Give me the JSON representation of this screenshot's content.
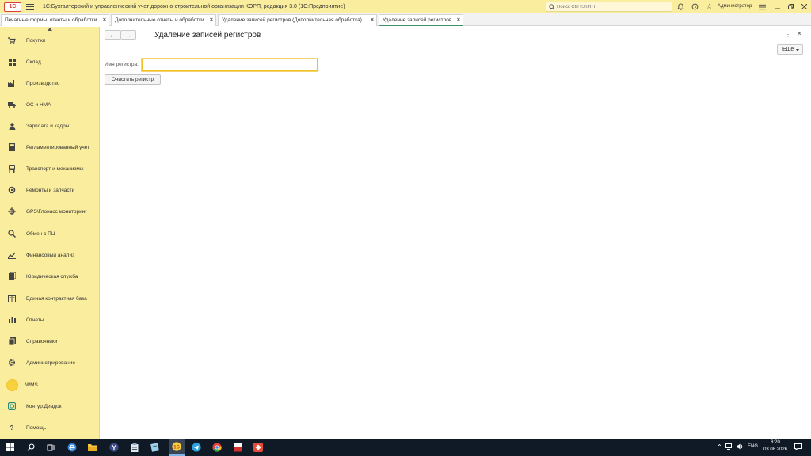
{
  "app": {
    "logo_text": "1С",
    "title": "1С:Бухгалтерский и управленческий учет дорожно-строительной организации КОРП, редакция 3.0  (1С:Предприятие)",
    "search_placeholder": "Поиск Ctrl+Shift+F",
    "user": "Администратор"
  },
  "tabs": [
    {
      "label": "Печатные формы, отчеты и обработки"
    },
    {
      "label": "Дополнительные отчеты и обработки"
    },
    {
      "label": "Удаление записей регистров (Дополнительная обработка)"
    },
    {
      "label": "Удаление записей регистров",
      "active": true
    }
  ],
  "sidebar": {
    "items": [
      {
        "label": "Покупки",
        "icon": "cart-icon"
      },
      {
        "label": "Склад",
        "icon": "warehouse-icon"
      },
      {
        "label": "Производство",
        "icon": "factory-icon"
      },
      {
        "label": "ОС и НМА",
        "icon": "truck-icon"
      },
      {
        "label": "Зарплата и кадры",
        "icon": "person-icon"
      },
      {
        "label": "Регламентированный учет",
        "icon": "calculator-icon"
      },
      {
        "label": "Транспорт и механизмы",
        "icon": "transport-icon"
      },
      {
        "label": "Ремонты и запчасти",
        "icon": "wrench-icon"
      },
      {
        "label": "GPS\\Глонасс мониторинг",
        "icon": "gps-icon"
      },
      {
        "label": "Обмен с ПЦ",
        "icon": "exchange-icon"
      },
      {
        "label": "Финансовый анализ",
        "icon": "chart-icon"
      },
      {
        "label": "Юридическая служба",
        "icon": "law-icon"
      },
      {
        "label": "Единая контрактная база",
        "icon": "book-icon"
      },
      {
        "label": "Отчеты",
        "icon": "reports-icon"
      },
      {
        "label": "Справочники",
        "icon": "catalogs-icon"
      },
      {
        "label": "Администрирование",
        "icon": "gear-icon"
      },
      {
        "label": "WMS",
        "icon": "wms-icon"
      },
      {
        "label": "Контур.Диадок",
        "icon": "diadoc-icon"
      },
      {
        "label": "Помощь",
        "icon": "help-icon"
      }
    ]
  },
  "form": {
    "title": "Удаление записей регистров",
    "more_label": "Еще",
    "register_label": "Имя регистра:",
    "register_value": "",
    "clear_button": "Очистить регистр"
  },
  "taskbar": {
    "time": "8:20",
    "date": "03.08.2026",
    "lang": "ENG"
  },
  "colors": {
    "panel_yellow": "#fbed9e",
    "active_tab_underline": "#3d8f6a",
    "input_focus": "#f0c028",
    "taskbar": "#101a26"
  }
}
